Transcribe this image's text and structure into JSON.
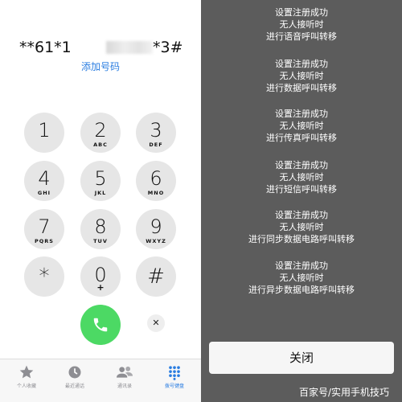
{
  "dialer": {
    "dialed_prefix": "**61*1",
    "dialed_suffix": "*3#",
    "add_number": "添加号码",
    "keys": [
      {
        "digit": "1",
        "letters": ""
      },
      {
        "digit": "2",
        "letters": "ABC"
      },
      {
        "digit": "3",
        "letters": "DEF"
      },
      {
        "digit": "4",
        "letters": "GHI"
      },
      {
        "digit": "5",
        "letters": "JKL"
      },
      {
        "digit": "6",
        "letters": "MNO"
      },
      {
        "digit": "7",
        "letters": "PQRS"
      },
      {
        "digit": "8",
        "letters": "TUV"
      },
      {
        "digit": "9",
        "letters": "WXYZ"
      },
      {
        "digit": "*",
        "letters": ""
      },
      {
        "digit": "0",
        "letters": "+"
      },
      {
        "digit": "#",
        "letters": ""
      }
    ],
    "call_icon": "phone-icon",
    "delete_icon": "close-icon",
    "delete_symbol": "✕",
    "tabs": [
      {
        "label": "个人收藏",
        "icon": "star-icon",
        "active": false
      },
      {
        "label": "最近通话",
        "icon": "clock-icon",
        "active": false
      },
      {
        "label": "通讯录",
        "icon": "contacts-icon",
        "active": false
      },
      {
        "label": "拨号键盘",
        "icon": "keypad-icon",
        "active": true
      }
    ],
    "colors": {
      "call_green": "#4cd964",
      "accent_blue": "#2a7de1",
      "key_gray": "#e6e6e6"
    }
  },
  "result": {
    "messages": [
      {
        "line1": "设置注册成功",
        "line2": "无人接听时",
        "line3": "进行语音呼叫转移"
      },
      {
        "line1": "设置注册成功",
        "line2": "无人接听时",
        "line3": "进行数据呼叫转移"
      },
      {
        "line1": "设置注册成功",
        "line2": "无人接听时",
        "line3": "进行传真呼叫转移"
      },
      {
        "line1": "设置注册成功",
        "line2": "无人接听时",
        "line3": "进行短信呼叫转移"
      },
      {
        "line1": "设置注册成功",
        "line2": "无人接听时",
        "line3": "进行同步数据电路呼叫转移"
      },
      {
        "line1": "设置注册成功",
        "line2": "无人接听时",
        "line3": "进行异步数据电路呼叫转移"
      }
    ],
    "close_label": "关闭",
    "watermark": "百家号/实用手机技巧",
    "colors": {
      "panel_bg": "#5c5c5c"
    }
  }
}
